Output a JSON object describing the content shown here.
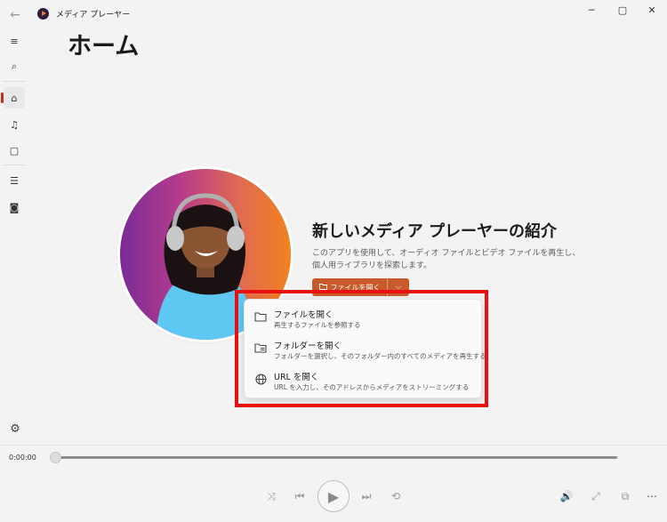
{
  "window": {
    "title": "メディア プレーヤー",
    "minimize": "─",
    "maximize": "▢",
    "close": "✕"
  },
  "nav": {
    "back_icon": "←",
    "menu_icon": "≡",
    "search_icon": "⌕",
    "home_icon": "⌂",
    "music_icon": "♫",
    "video_icon": "▢",
    "playqueue_icon": "☰",
    "playlist_icon": "◙",
    "settings_icon": "⚙"
  },
  "page": {
    "title": "ホーム"
  },
  "intro": {
    "title": "新しいメディア プレーヤーの紹介",
    "description": "このアプリを使用して、オーディオ ファイルとビデオ ファイルを再生し、個人用ライブラリを探索します。"
  },
  "open_button": {
    "label": "ファイルを開く",
    "arrow": "⌵"
  },
  "menu": {
    "items": [
      {
        "label": "ファイルを開く",
        "sub": "再生するファイルを参照する",
        "icon": "folder-icon"
      },
      {
        "label": "フォルダーを開く",
        "sub": "フォルダーを選択し、そのフォルダー内のすべてのメディアを再生する",
        "icon": "folder-list-icon"
      },
      {
        "label": "URL を開く",
        "sub": "URL を入力し、そのアドレスからメディアをストリーミングする",
        "icon": "globe-icon"
      }
    ]
  },
  "player": {
    "time": "0:00:00",
    "progress": 0,
    "icons": {
      "shuffle": "⤨",
      "previous": "⏮",
      "play": "▶",
      "next": "⏭",
      "repeat": "⟲",
      "volume": "🔊",
      "fullscreen": "⤢",
      "miniplayer": "⧉",
      "more": "⋯"
    }
  },
  "colors": {
    "accent": "#c95a2b",
    "highlight": "#e81010"
  }
}
